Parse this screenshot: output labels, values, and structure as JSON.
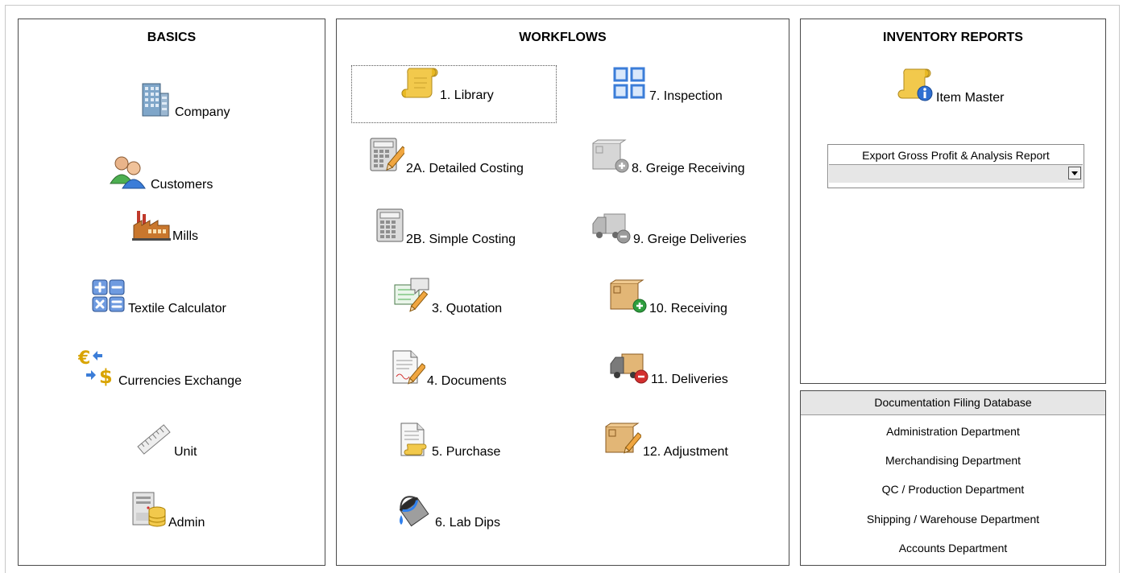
{
  "basics": {
    "title": "BASICS",
    "items": [
      {
        "label": "Company",
        "icon": "building-icon"
      },
      {
        "label": "Customers",
        "icon": "users-icon"
      },
      {
        "label": "Mills",
        "icon": "factory-icon"
      },
      {
        "label": "Textile Calculator",
        "icon": "calculator-keys-icon"
      },
      {
        "label": "Currencies Exchange",
        "icon": "currency-exchange-icon"
      },
      {
        "label": "Unit",
        "icon": "ruler-icon"
      },
      {
        "label": "Admin",
        "icon": "server-database-icon"
      }
    ]
  },
  "workflows": {
    "title": "WORKFLOWS",
    "items": [
      {
        "label": "1. Library",
        "icon": "scroll-icon"
      },
      {
        "label": "2A. Detailed Costing",
        "icon": "calculator-pencil-icon"
      },
      {
        "label": "2B. Simple Costing",
        "icon": "calculator-icon"
      },
      {
        "label": "3. Quotation",
        "icon": "quotation-icon"
      },
      {
        "label": "4. Documents",
        "icon": "document-sign-icon"
      },
      {
        "label": "5. Purchase",
        "icon": "purchase-document-icon"
      },
      {
        "label": "6. Lab Dips",
        "icon": "paint-bucket-icon"
      },
      {
        "label": "7. Inspection",
        "icon": "grid-icon"
      },
      {
        "label": "8. Greige Receiving",
        "icon": "box-add-gray-icon"
      },
      {
        "label": "9. Greige Deliveries",
        "icon": "truck-remove-gray-icon"
      },
      {
        "label": "10. Receiving",
        "icon": "box-add-icon"
      },
      {
        "label": "11. Deliveries",
        "icon": "truck-remove-icon"
      },
      {
        "label": "12. Adjustment",
        "icon": "box-edit-icon"
      }
    ]
  },
  "inventory": {
    "title": "INVENTORY REPORTS",
    "item_master": "Item Master",
    "export_label": "Export Gross Profit & Analysis Report",
    "export_value": ""
  },
  "documentation": {
    "title": "Documentation Filing Database",
    "departments": [
      "Administration Department",
      "Merchandising Department",
      "QC / Production Department",
      "Shipping / Warehouse Department",
      "Accounts Department"
    ]
  },
  "colors": {
    "panel_border": "#4a4a4a",
    "header_bg": "#e6e6e6",
    "icon_blue": "#3b7dd8",
    "scroll_yellow": "#f2c94c",
    "add_green": "#2e9e3e",
    "remove_red": "#d32f2f"
  }
}
